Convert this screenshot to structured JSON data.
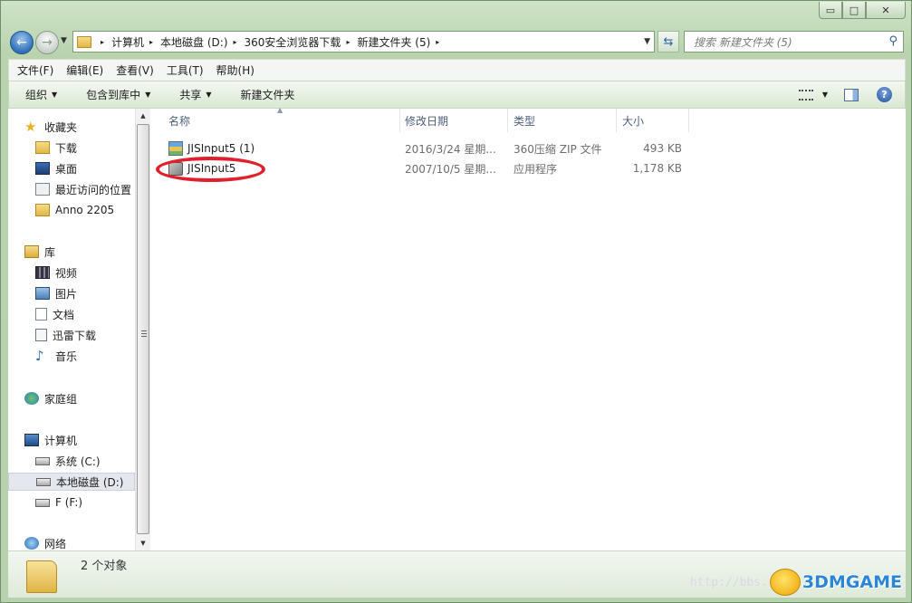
{
  "window": {
    "caption_min": "▭",
    "caption_max": "□",
    "caption_close": "✕"
  },
  "nav": {
    "back_glyph": "←",
    "forward_glyph": "→",
    "history_glyph": "▼",
    "breadcrumbs": [
      "计算机",
      "本地磁盘 (D:)",
      "360安全浏览器下载",
      "新建文件夹 (5)"
    ],
    "crumb_sep": "▸",
    "address_dropdown": "▼",
    "refresh_glyph": "⇆",
    "search_placeholder": "搜索 新建文件夹 (5)",
    "search_glyph": "⚲"
  },
  "menu": [
    "文件(F)",
    "编辑(E)",
    "查看(V)",
    "工具(T)",
    "帮助(H)"
  ],
  "commands": [
    {
      "label": "组织",
      "has_menu": true
    },
    {
      "label": "包含到库中",
      "has_menu": true
    },
    {
      "label": "共享",
      "has_menu": true
    },
    {
      "label": "新建文件夹",
      "has_menu": false
    }
  ],
  "cmd_tri": "▼",
  "help_glyph": "?",
  "sidebar": {
    "favorites": {
      "label": "收藏夹",
      "icon": "star-icon",
      "color": "#e6b422"
    },
    "favorite_items": [
      {
        "label": "下载",
        "icon": "downloads-folder-icon"
      },
      {
        "label": "桌面",
        "icon": "desktop-icon"
      },
      {
        "label": "最近访问的位置",
        "icon": "recent-places-icon"
      },
      {
        "label": "Anno 2205",
        "icon": "folder-icon"
      }
    ],
    "libraries": {
      "label": "库",
      "icon": "library-icon"
    },
    "library_items": [
      {
        "label": "视频",
        "icon": "video-icon"
      },
      {
        "label": "图片",
        "icon": "pictures-icon"
      },
      {
        "label": "文档",
        "icon": "documents-icon"
      },
      {
        "label": "迅雷下载",
        "icon": "thunder-download-icon"
      },
      {
        "label": "音乐",
        "icon": "music-icon"
      }
    ],
    "homegroup": {
      "label": "家庭组",
      "icon": "homegroup-icon"
    },
    "computer": {
      "label": "计算机",
      "icon": "computer-icon"
    },
    "computer_items": [
      {
        "label": "系统 (C:)",
        "icon": "system-drive-icon",
        "selected": false
      },
      {
        "label": "本地磁盘 (D:)",
        "icon": "local-disk-icon",
        "selected": true
      },
      {
        "label": "F (F:)",
        "icon": "removable-drive-icon",
        "selected": false
      }
    ],
    "network": {
      "label": "网络",
      "icon": "network-icon"
    }
  },
  "scroll": {
    "up": "▲",
    "down": "▼"
  },
  "columns": [
    "名称",
    "修改日期",
    "类型",
    "大小"
  ],
  "sort_arrow": "▲",
  "files": [
    {
      "name": "JISInput5 (1)",
      "date": "2016/3/24 星期...",
      "type": "360压缩 ZIP 文件",
      "size": "493 KB",
      "icon": "zip-archive-icon"
    },
    {
      "name": "JISInput5",
      "date": "2007/10/5 星期...",
      "type": "应用程序",
      "size": "1,178 KB",
      "icon": "application-exe-icon"
    }
  ],
  "highlight_color": "#e0202a",
  "status": {
    "count": "2 个对象"
  },
  "watermark": {
    "url": "http://bbs.",
    "brand": "3DMGAME"
  }
}
